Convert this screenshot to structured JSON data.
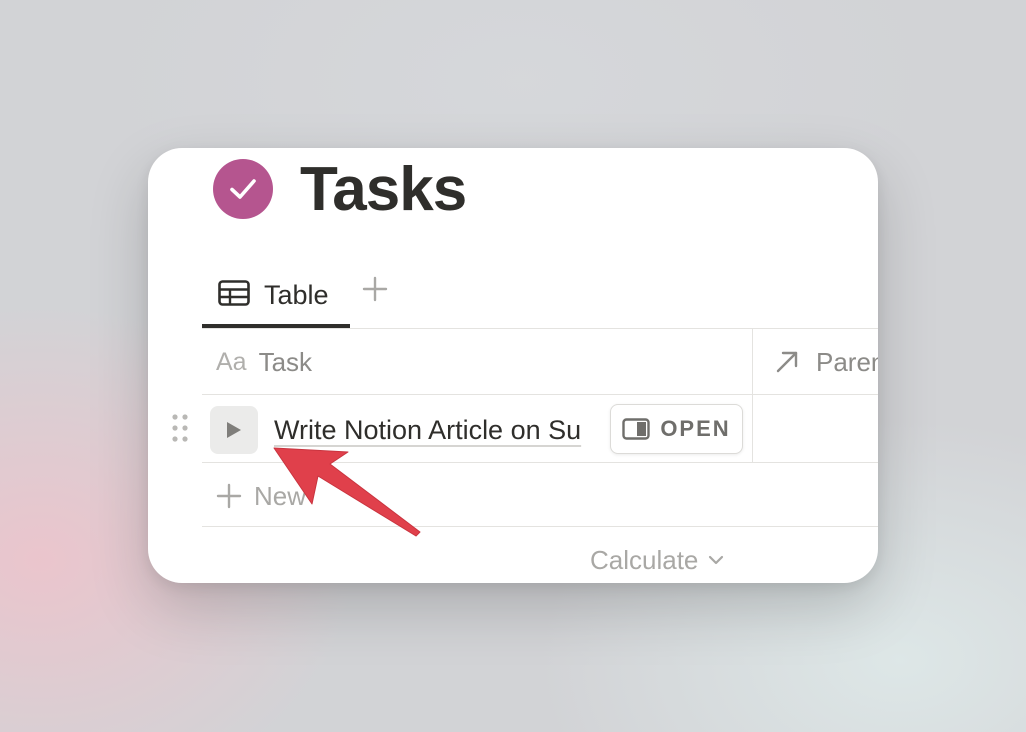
{
  "page": {
    "title": "Tasks",
    "icon": "purple-checkmark-circle-icon",
    "icon_color": "#b5558f"
  },
  "view_tabs": [
    {
      "label": "Table",
      "icon": "table-icon",
      "active": true
    }
  ],
  "columns": [
    {
      "label": "Task",
      "icon_text": "Aa"
    },
    {
      "label": "Paren",
      "icon": "arrow-up-right-icon"
    }
  ],
  "rows": [
    {
      "title": "Write Notion Article on Su",
      "open_label": "OPEN"
    }
  ],
  "new_row_label": "New",
  "calculate_label": "Calculate",
  "colors": {
    "text": "#2f2e2b",
    "muted": "#8c8b88",
    "annotation_arrow": "#e0404b"
  }
}
